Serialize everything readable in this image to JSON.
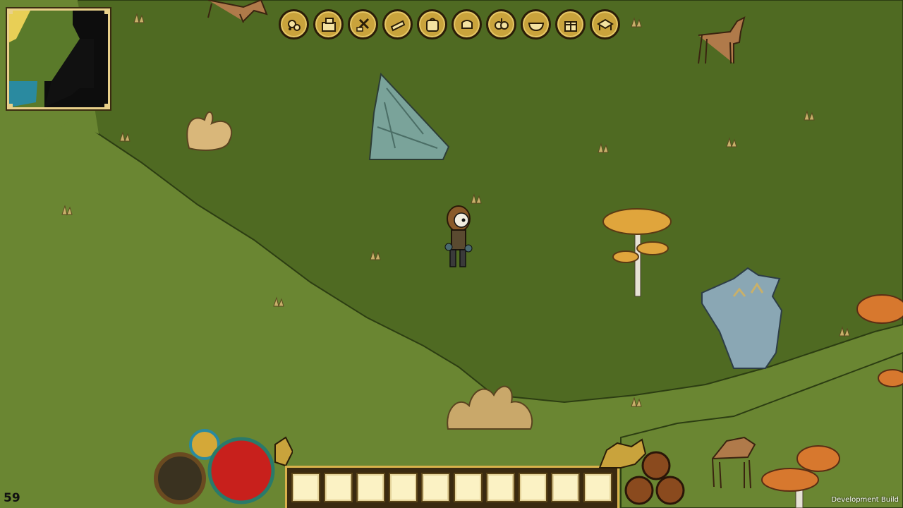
{
  "hud": {
    "fps": "59",
    "watermark": "Development Build"
  },
  "minimap": {
    "icon": "world-minimap"
  },
  "crafting": {
    "categories": [
      {
        "icon": "forage-icon"
      },
      {
        "icon": "blocks-icon"
      },
      {
        "icon": "tools-icon"
      },
      {
        "icon": "telescope-icon"
      },
      {
        "icon": "backpack-icon"
      },
      {
        "icon": "fist-icon"
      },
      {
        "icon": "food-icon"
      },
      {
        "icon": "bowl-icon"
      },
      {
        "icon": "gift-icon"
      },
      {
        "icon": "workbench-icon"
      }
    ]
  },
  "player": {
    "health": 1.0,
    "hunger": 0.0,
    "stamina": 1.0
  },
  "hotbar": {
    "slot_count": 10
  },
  "colors": {
    "grass_light": "#6a8632",
    "grass_dark": "#4f6a22",
    "hud_gold": "#c9a33c",
    "health_red": "#c8201c"
  }
}
